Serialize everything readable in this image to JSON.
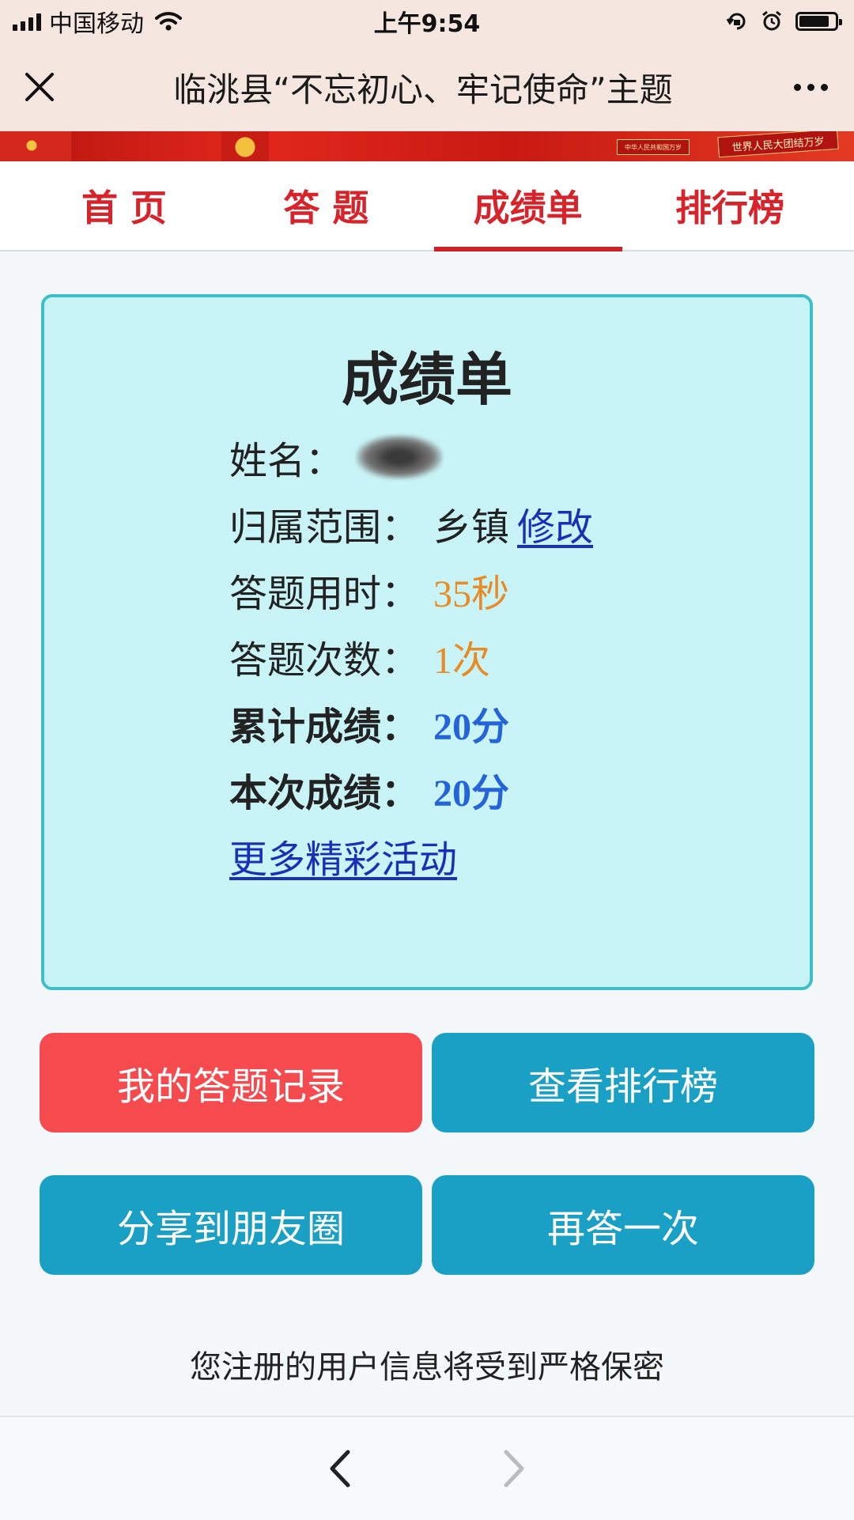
{
  "status_bar": {
    "carrier": "中国移动",
    "time": "上午9:54",
    "battery_level": 0.85
  },
  "nav": {
    "title": "临洮县“不忘初心、牢记使命”主题",
    "close_icon": "close-icon",
    "more_icon": "more-icon"
  },
  "banner": {
    "sign_small": "中华人民共和国万岁",
    "sign_large": "世界人民大团结万岁"
  },
  "tabs": [
    {
      "label": "首 页",
      "active": false
    },
    {
      "label": "答 题",
      "active": false
    },
    {
      "label": "成绩单",
      "active": true
    },
    {
      "label": "排行榜",
      "active": false
    }
  ],
  "card": {
    "title": "成绩单",
    "name_label": "姓名：",
    "scope_label": "归属范围：",
    "scope_value": "乡镇",
    "scope_edit": "修改",
    "time_label": "答题用时：",
    "time_value": "35秒",
    "count_label": "答题次数：",
    "count_value": "1次",
    "total_label": "累计成绩：",
    "total_value": "20分",
    "current_label": "本次成绩：",
    "current_value": "20分",
    "more_link": "更多精彩活动"
  },
  "buttons": {
    "my_records": "我的答题记录",
    "view_ranking": "查看排行榜",
    "share": "分享到朋友圈",
    "retry": "再答一次"
  },
  "privacy_note": "您注册的用户信息将受到严格保密",
  "colors": {
    "tab_red": "#d6242a",
    "card_bg": "#c9f4f7",
    "card_border": "#3dbec9",
    "btn_red": "#f54a4e",
    "btn_teal": "#1aa0c4",
    "orange_value": "#e88a25",
    "blue_value": "#2563d8",
    "link_blue": "#1a2fb5"
  }
}
